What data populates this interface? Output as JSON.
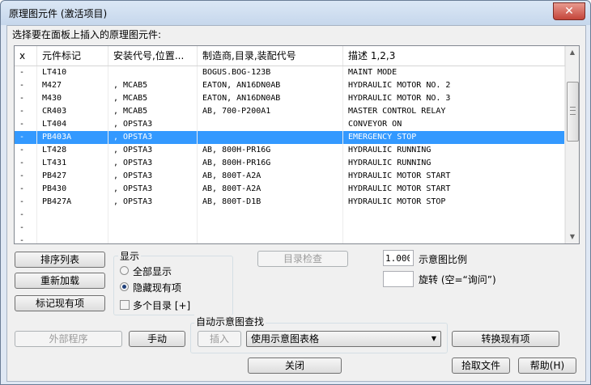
{
  "window": {
    "title": "原理图元件 (激活项目)",
    "close_glyph": "✕"
  },
  "prompt": "选择要在面板上插入的原理图元件:",
  "table": {
    "columns": [
      "x",
      "元件标记",
      "安装代号,位置...",
      "制造商,目录,装配代号",
      "描述 1,2,3"
    ],
    "rows": [
      [
        "-",
        "LT410",
        "",
        "BOGUS.BOG-123B",
        "MAINT MODE"
      ],
      [
        "-",
        "M427",
        ", MCAB5",
        "EATON, AN16DN0AB",
        "HYDRAULIC MOTOR NO. 2"
      ],
      [
        "-",
        "M430",
        ", MCAB5",
        "EATON, AN16DN0AB",
        "HYDRAULIC MOTOR NO. 3"
      ],
      [
        "-",
        "CR403",
        ", MCAB5",
        "AB, 700-P200A1",
        "MASTER CONTROL RELAY"
      ],
      [
        "-",
        "LT404",
        ", OPSTA3",
        "",
        "CONVEYOR ON"
      ],
      [
        "-",
        "PB403A",
        ", OPSTA3",
        "",
        "EMERGENCY STOP"
      ],
      [
        "-",
        "LT428",
        ", OPSTA3",
        "AB, 800H-PR16G",
        "HYDRAULIC RUNNING"
      ],
      [
        "-",
        "LT431",
        ", OPSTA3",
        "AB, 800H-PR16G",
        "HYDRAULIC RUNNING"
      ],
      [
        "-",
        "PB427",
        ", OPSTA3",
        "AB, 800T-A2A",
        "HYDRAULIC MOTOR START"
      ],
      [
        "-",
        "PB430",
        ", OPSTA3",
        "AB, 800T-A2A",
        "HYDRAULIC MOTOR START"
      ],
      [
        "-",
        "PB427A",
        ", OPSTA3",
        "AB, 800T-D1B",
        "HYDRAULIC MOTOR STOP"
      ],
      [
        "-",
        "",
        "",
        "",
        ""
      ],
      [
        "-",
        "",
        "",
        "",
        ""
      ],
      [
        "-",
        "",
        "",
        "",
        ""
      ]
    ],
    "selected_row": 5
  },
  "buttons": {
    "sort": "排序列表",
    "reload": "重新加载",
    "mark_existing": "标记现有项",
    "catalog_check": "目录检查",
    "external_program": "外部程序",
    "manual": "手动",
    "insert": "插入",
    "convert_existing": "转换现有项",
    "close": "关闭",
    "pick_file": "拾取文件",
    "help": "帮助(H)"
  },
  "display": {
    "label": "显示",
    "show_all": "全部显示",
    "hide_existing": "隐藏现有项",
    "multi_catalog": "多个目录 [+]"
  },
  "scale": {
    "value": "1.000",
    "label": "示意图比例"
  },
  "rotate": {
    "value": "",
    "label": "旋转 (空=“询问”)"
  },
  "auto_lookup": {
    "label": "自动示意图查找",
    "selected": "使用示意图表格"
  },
  "icons": {
    "scroll_up": "▲",
    "scroll_down": "▼",
    "dropdown": "▼"
  }
}
